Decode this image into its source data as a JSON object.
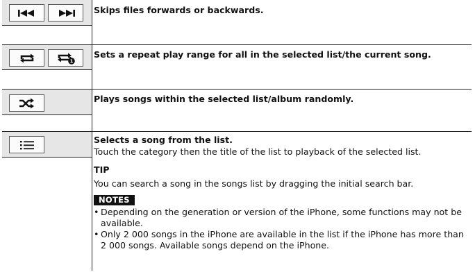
{
  "rows": [
    {
      "icons": [
        "skip-back-icon",
        "skip-forward-icon"
      ],
      "description": "Skips files forwards or backwards."
    },
    {
      "icons": [
        "repeat-all-icon",
        "repeat-one-icon"
      ],
      "description": "Sets a repeat play range for all in the selected list/the current song."
    },
    {
      "icons": [
        "shuffle-icon"
      ],
      "description": "Plays songs within the selected list/album randomly."
    },
    {
      "icons": [
        "list-icon"
      ],
      "description": "Selects a song from the list.",
      "detail": "Touch the category then the title of the list to playback of the selected list.",
      "tip_heading": "TIP",
      "tip_text": "You can search a song in the songs list by dragging the initial search bar.",
      "notes_heading": "NOTES",
      "notes": [
        "Depending on the generation or version of the iPhone, some functions may not be available.",
        "Only 2 000 songs in the iPhone are available in the list if the iPhone has more than 2 000 songs. Available songs depend on the iPhone."
      ]
    }
  ]
}
